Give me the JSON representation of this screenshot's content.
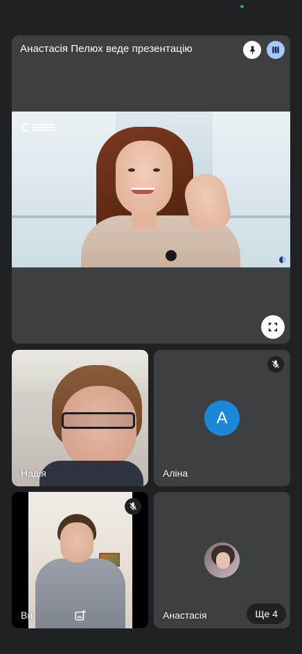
{
  "presentation": {
    "title": "Анастасія Пелюх веде презентацію",
    "pin_icon": "pin-icon",
    "layout_icon": "layout-icon",
    "fullscreen_icon": "fullscreen-icon"
  },
  "participants": [
    {
      "name": "Надія",
      "muted": false
    },
    {
      "name": "Аліна",
      "muted": true,
      "avatar_letter": "A",
      "avatar_color": "#1a88d6"
    },
    {
      "name": "Ви",
      "muted": true
    },
    {
      "name": "Анастасія",
      "muted": false
    }
  ],
  "more_participants_label": "Ще 4",
  "colors": {
    "background": "#202124",
    "tile": "#3c4043",
    "layout_button": "#a8c7fa",
    "status_dot": "#34a853"
  }
}
